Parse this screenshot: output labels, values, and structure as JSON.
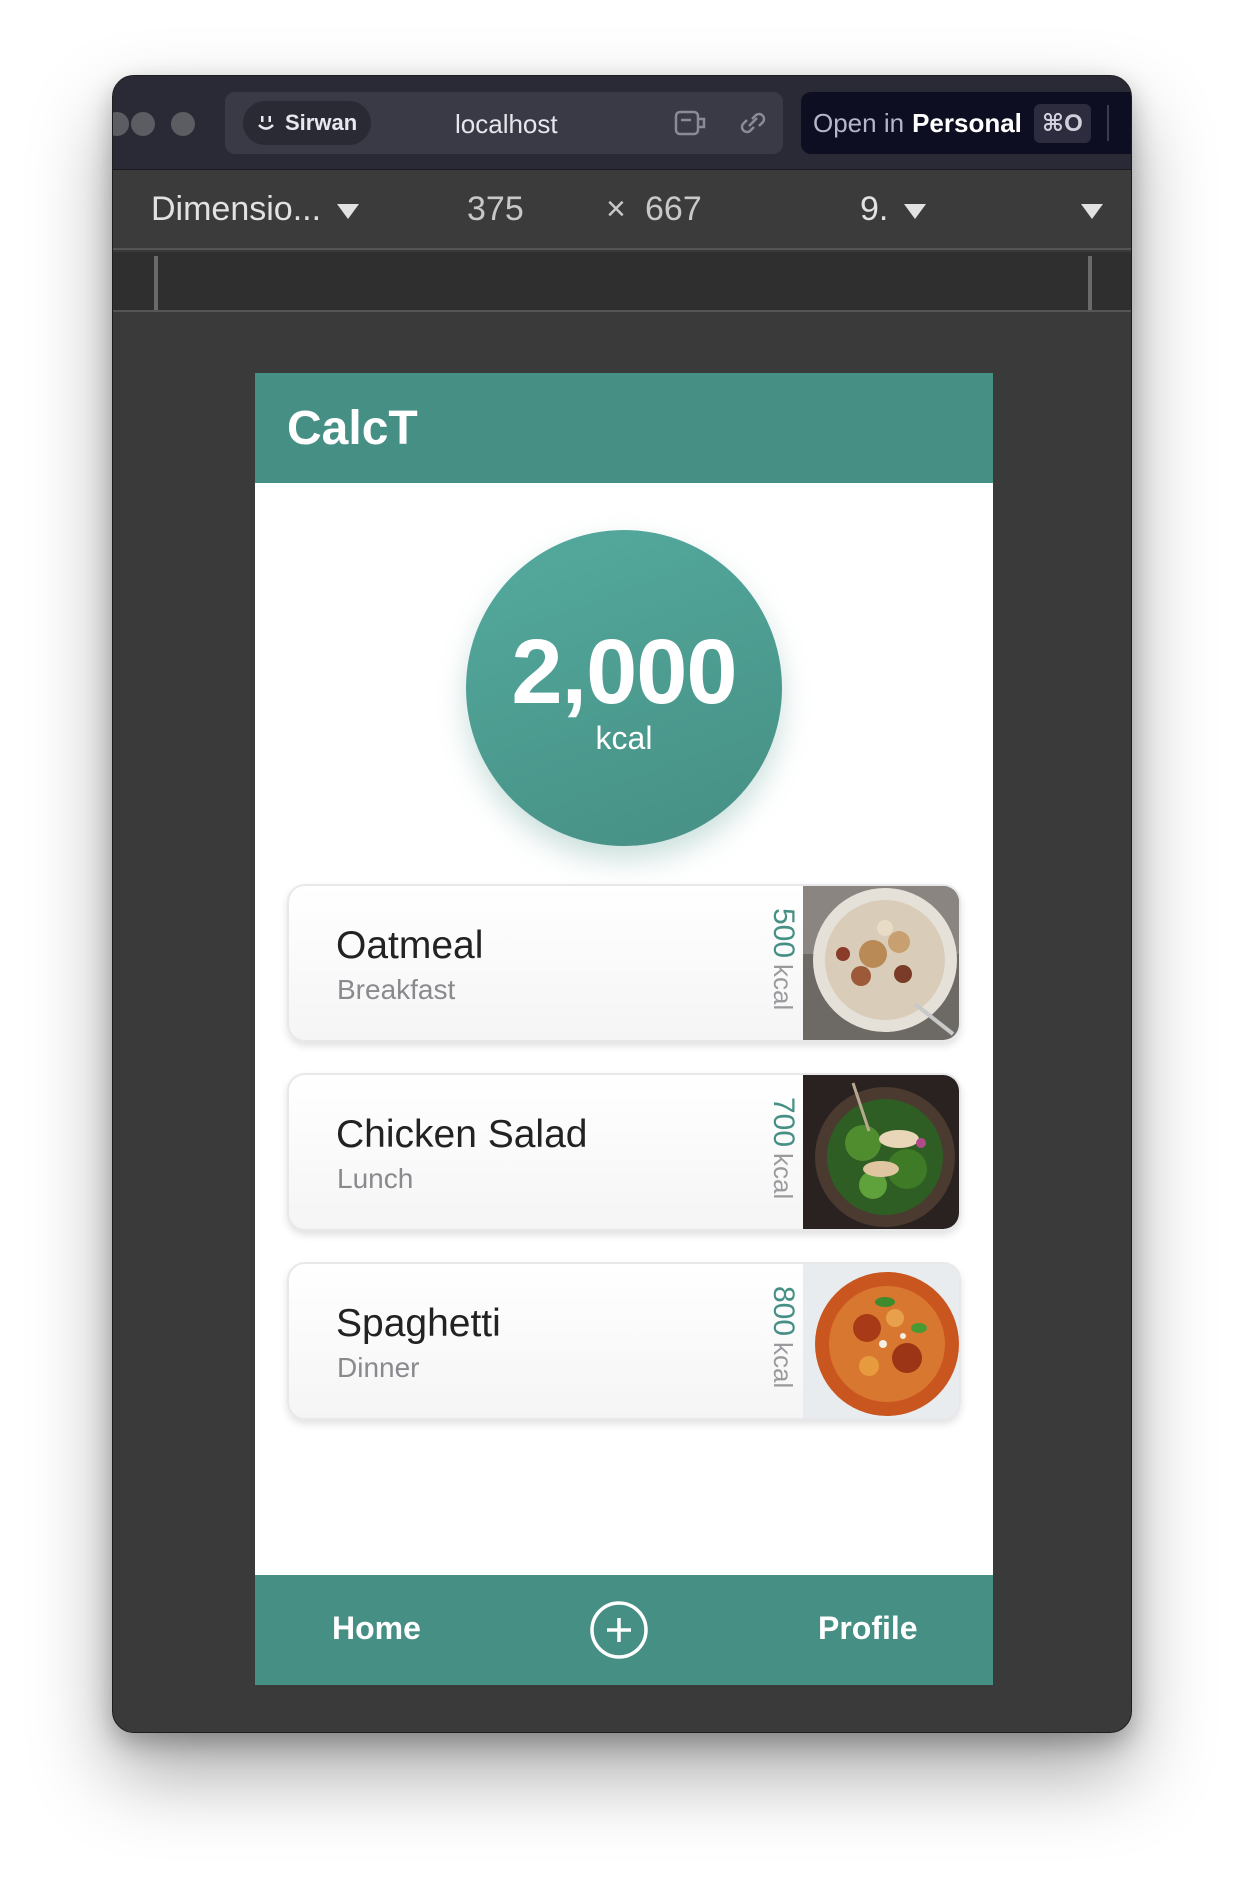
{
  "browser": {
    "profile_name": "Sirwan",
    "url": "localhost",
    "open_in_prefix": "Open in",
    "open_in_target": "Personal",
    "open_in_shortcut": "⌘O"
  },
  "devtools": {
    "device": "Dimensio...",
    "width": "375",
    "times": "×",
    "height": "667",
    "zoom": "9."
  },
  "app": {
    "title": "CalcT",
    "total": {
      "value": "2,000",
      "unit": "kcal"
    },
    "meals": [
      {
        "name": "Oatmeal",
        "type": "Breakfast",
        "kcal": "500",
        "unit": "kcal",
        "image": "oatmeal-photo"
      },
      {
        "name": "Chicken Salad",
        "type": "Lunch",
        "kcal": "700",
        "unit": "kcal",
        "image": "chicken-salad-photo"
      },
      {
        "name": "Spaghetti",
        "type": "Dinner",
        "kcal": "800",
        "unit": "kcal",
        "image": "spaghetti-photo"
      }
    ],
    "tabbar": {
      "home": "Home",
      "add_icon": "plus-circle-icon",
      "profile": "Profile"
    }
  },
  "colors": {
    "accent": "#468f84",
    "accent_light": "#54aa9e"
  }
}
